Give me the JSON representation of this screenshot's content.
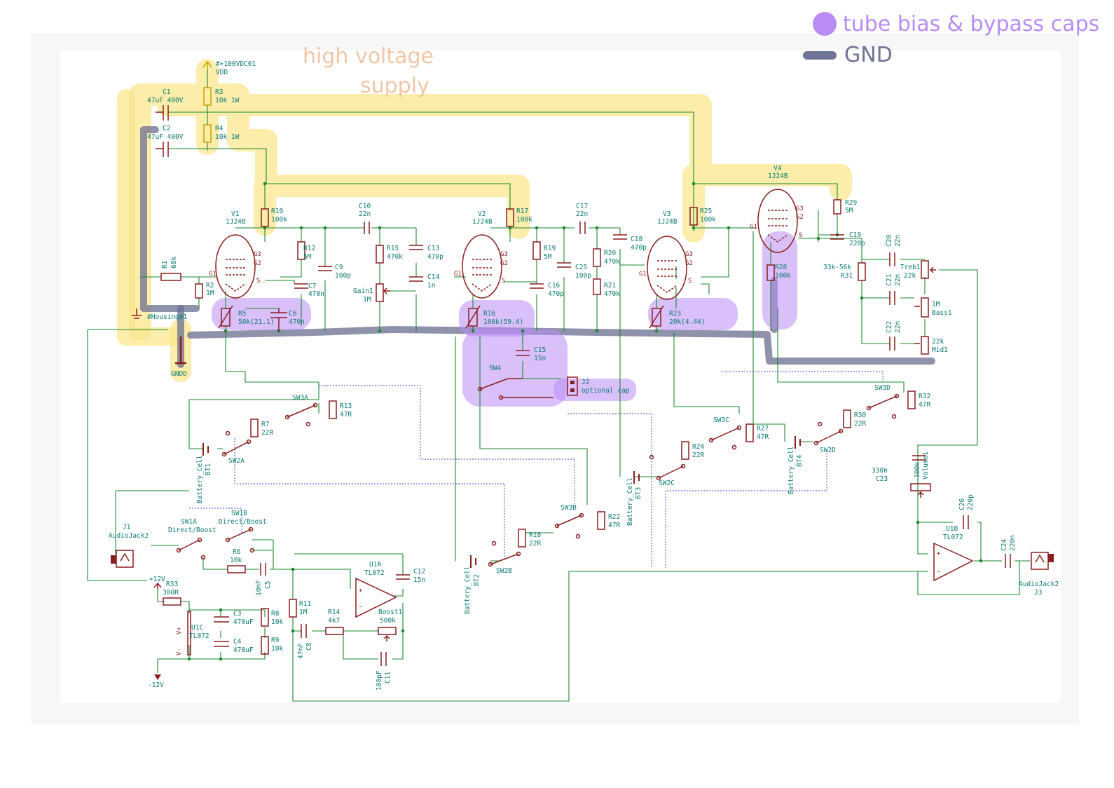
{
  "legend": {
    "bias_label": "tube bias & bypass caps",
    "gnd_label": "GND",
    "bias_color": "#b98cf5",
    "gnd_color": "#6f7394"
  },
  "annotations": {
    "hv_line1": "high voltage",
    "hv_line2": "supply",
    "hv_color": "#f2c5a4"
  },
  "supply": {
    "vdd_net": "#+100VDC01",
    "vdd_label": "VDD",
    "c1_ref": "C1",
    "c1_val": "47uF 400V",
    "c2_ref": "C2",
    "c2_val": "47uF 400V",
    "r3_ref": "R3",
    "r3_val": "10k 1W",
    "r4_ref": "R4",
    "r4_val": "10k 1W",
    "housing": "#Housing01",
    "gndd": "GNDD"
  },
  "tubes": [
    {
      "ref": "V1",
      "type": "1J24B"
    },
    {
      "ref": "V2",
      "type": "1J24B"
    },
    {
      "ref": "V3",
      "type": "1J24B"
    },
    {
      "ref": "V4",
      "type": "1J24B"
    }
  ],
  "parts": {
    "r1": [
      "R1",
      "68k"
    ],
    "r2": [
      "R2",
      "1M"
    ],
    "r5": [
      "R5",
      "50k(21.1)"
    ],
    "c6": [
      "C6",
      "470n"
    ],
    "r10": [
      "R10",
      "100k"
    ],
    "r12": [
      "R12",
      "5M"
    ],
    "c7": [
      "C7",
      "470n"
    ],
    "c9": [
      "C9",
      "100p"
    ],
    "c10": [
      "C10",
      "22n"
    ],
    "r15": [
      "R15",
      "470k"
    ],
    "c13": [
      "C13",
      "470p"
    ],
    "c14": [
      "C14",
      "1n"
    ],
    "gain1": [
      "Gain1",
      "1M"
    ],
    "r17": [
      "R17",
      "100k"
    ],
    "r19": [
      "R19",
      "5M"
    ],
    "c16": [
      "C16",
      "470p"
    ],
    "r16": [
      "R16",
      "100k(59.4)"
    ],
    "c15": [
      "C15",
      "15n"
    ],
    "sw4": [
      "SW4",
      ""
    ],
    "j2": [
      "J2",
      "optional cap"
    ],
    "c17": [
      "C17",
      "22n"
    ],
    "c25": [
      "C25",
      "100p"
    ],
    "r20": [
      "R20",
      "470k"
    ],
    "r21": [
      "R21",
      "470k"
    ],
    "c18": [
      "C18",
      "470p"
    ],
    "r25": [
      "R25",
      "100k"
    ],
    "r23": [
      "R23",
      "20k(4.44)"
    ],
    "r29": [
      "R29",
      "5M"
    ],
    "c19": [
      "C19",
      "220p"
    ],
    "r28": [
      "R28",
      "100k"
    ],
    "r31": [
      "R31",
      "33k-56k"
    ],
    "c20": [
      "C20",
      "22n"
    ],
    "c21": [
      "C21",
      "22n"
    ],
    "c22": [
      "C22",
      "22n"
    ],
    "treb1": [
      "Treb1",
      "22k"
    ],
    "bass1": [
      "Bass1",
      "1M"
    ],
    "mid1": [
      "Mid1",
      "22k"
    ],
    "r7": [
      "R7",
      "22R"
    ],
    "r13": [
      "R13",
      "47R"
    ],
    "sw3a": [
      "SW3A",
      ""
    ],
    "sw2a": [
      "SW2A",
      ""
    ],
    "bt1": [
      "BT1",
      "Battery_Cell"
    ],
    "r18": [
      "R18",
      "22R"
    ],
    "r22": [
      "R22",
      "47R"
    ],
    "sw3b": [
      "SW3B",
      ""
    ],
    "sw2b": [
      "SW2B",
      ""
    ],
    "bt2": [
      "BT2",
      "Battery_Cell"
    ],
    "r24": [
      "R24",
      "22R"
    ],
    "r27": [
      "R27",
      "47R"
    ],
    "sw3c": [
      "SW3C",
      ""
    ],
    "sw2c": [
      "SW2C",
      ""
    ],
    "bt3": [
      "BT3",
      "Battery_Cell"
    ],
    "r30": [
      "R30",
      "22R"
    ],
    "r32": [
      "R32",
      "47R"
    ],
    "sw3d": [
      "SW3D",
      ""
    ],
    "sw2d": [
      "SW2D",
      ""
    ],
    "bt4": [
      "BT4",
      "Battery_Cell"
    ],
    "j1": [
      "J1",
      "AudioJack2"
    ],
    "sw1a": [
      "SW1A",
      "Direct/Boost"
    ],
    "sw1b": [
      "SW1B",
      "Direct/Boost"
    ],
    "r6": [
      "R6",
      "10k"
    ],
    "c5": [
      "C5",
      "10nF"
    ],
    "c12": [
      "C12",
      "15n"
    ],
    "u1a": [
      "U1A",
      "TL072"
    ],
    "r11": [
      "R11",
      "1M"
    ],
    "r14": [
      "R14",
      "4k7"
    ],
    "c8": [
      "C8",
      "47nF"
    ],
    "boost1": [
      "Boost1",
      "500k"
    ],
    "c11": [
      "C11",
      "100pF"
    ],
    "r33": [
      "R33",
      "300R"
    ],
    "u1c": [
      "U1C",
      "TL072"
    ],
    "c3": [
      "C3",
      "470uF"
    ],
    "c4": [
      "C4",
      "470uF"
    ],
    "r8": [
      "R8",
      "10k"
    ],
    "r9": [
      "R9",
      "10k"
    ],
    "c23": [
      "C23",
      "330n"
    ],
    "volume1": [
      "Volume1",
      "100k"
    ],
    "c26": [
      "C26",
      "220p"
    ],
    "u1b": [
      "U1B",
      "TL072"
    ],
    "c24": [
      "C24",
      "220n"
    ],
    "j3": [
      "J3",
      "AudioJack2"
    ]
  },
  "power": {
    "plus12": "+12V",
    "minus12": "-12V",
    "vplus": "V+",
    "vminus": "V-"
  }
}
